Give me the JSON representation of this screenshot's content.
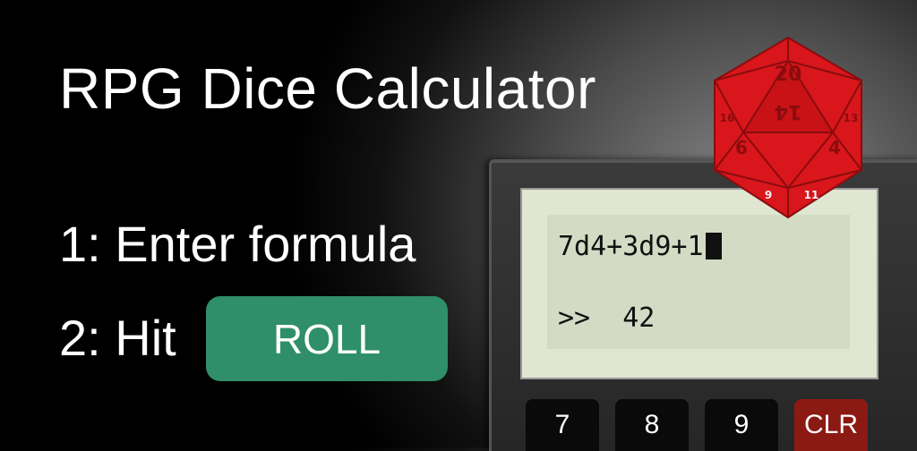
{
  "title": "RPG Dice Calculator",
  "steps": {
    "step1": "1: Enter formula",
    "step2_prefix": "2: Hit",
    "roll_label": "ROLL"
  },
  "display": {
    "formula": "7d4+3d9+1",
    "result_prompt": ">>",
    "result": "42"
  },
  "keys": [
    "7",
    "8",
    "9",
    "CLR"
  ],
  "dice_numbers": {
    "top": "20",
    "center": "14",
    "left": "16",
    "right": "13",
    "lower_left": "6",
    "lower_right": "4",
    "bottom_left": "9",
    "bottom_right": "11"
  },
  "colors": {
    "roll_button": "#2f8f6a",
    "clear_key": "#8c1a14",
    "dice": "#d8161b",
    "lcd": "#d3dbc4"
  },
  "icons": {
    "dice": "d20-dice-icon"
  }
}
